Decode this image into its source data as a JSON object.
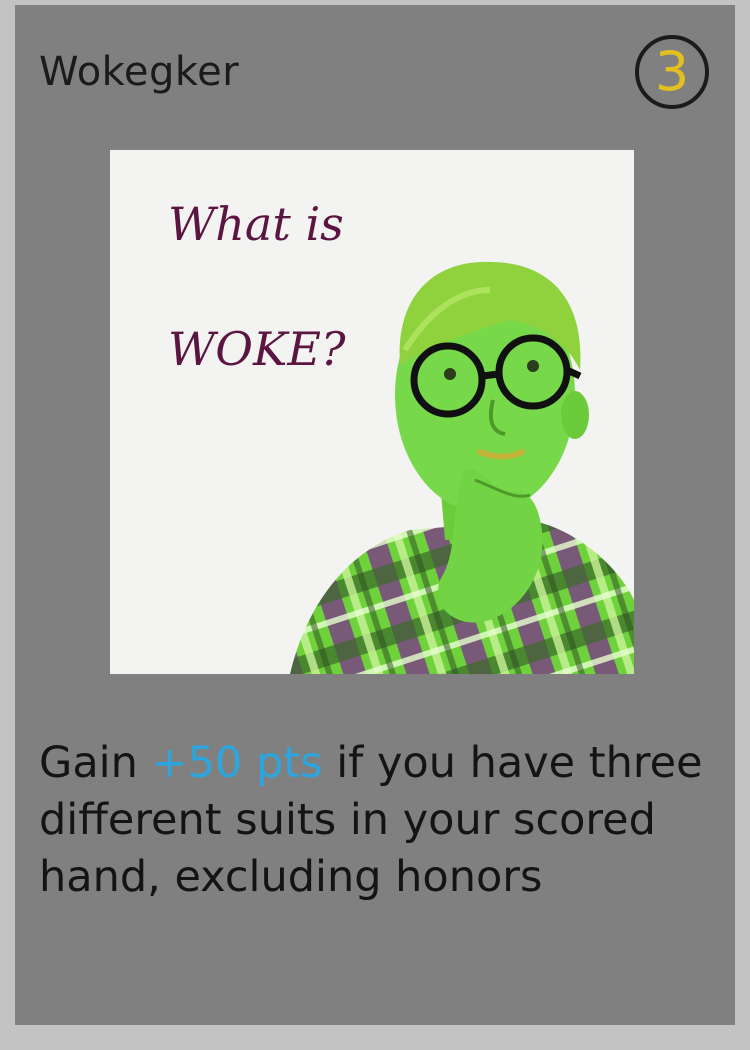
{
  "card": {
    "title": "Wokegker",
    "cost": "3",
    "art": {
      "caption_line1": "What is",
      "caption_line2": "WOKE?"
    },
    "rules": {
      "prefix": "Gain ",
      "highlight": "+50 pts",
      "suffix": " if you have three different suits in your scored hand, excluding honors"
    }
  },
  "colors": {
    "page_background": "#c3c3c3",
    "card_background": "#808080",
    "title_text": "#1b1b1b",
    "cost_digit": "#e2c021",
    "highlight": "#2ba6de",
    "caption": "#5a1540",
    "art_tint": "#7be04a"
  }
}
